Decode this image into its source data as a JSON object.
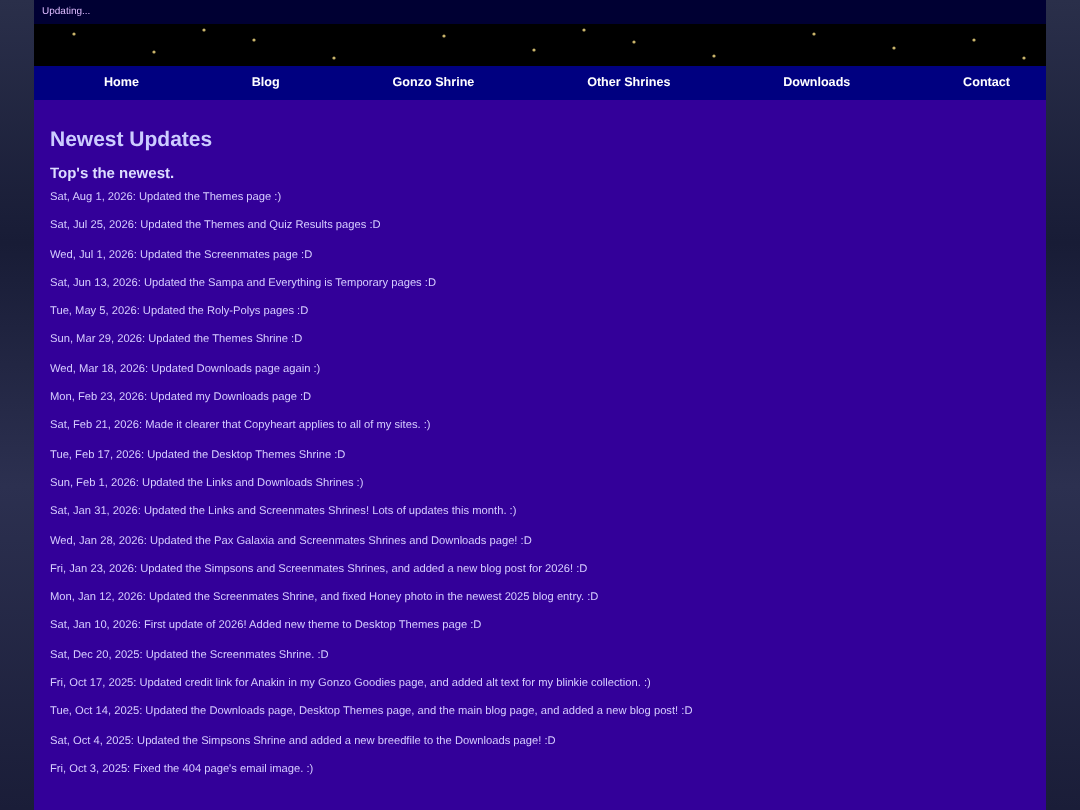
{
  "status_text": "Updating...",
  "nav": [
    {
      "label": "Home"
    },
    {
      "label": "Blog"
    },
    {
      "label": "Gonzo Shrine"
    },
    {
      "label": "Other Shrines"
    },
    {
      "label": "Downloads"
    },
    {
      "label": "Contact"
    }
  ],
  "heading": "Newest Updates",
  "subheading": "Top's the newest.",
  "updates": [
    "Sat, Aug 1, 2026: Updated the Themes page :)",
    "Sat, Jul 25, 2026: Updated the Themes and Quiz Results pages :D",
    "Wed, Jul 1, 2026: Updated the Screenmates page :D",
    "Sat, Jun 13, 2026: Updated the Sampa and Everything is Temporary pages :D",
    "Tue, May 5, 2026: Updated the Roly-Polys pages :D",
    "Sun, Mar 29, 2026: Updated the Themes Shrine :D",
    "Wed, Mar 18, 2026: Updated Downloads page again :)",
    "Mon, Feb 23, 2026: Updated my Downloads page :D",
    "Sat, Feb 21, 2026: Made it clearer that Copyheart applies to all of my sites. :)",
    "Tue, Feb 17, 2026: Updated the Desktop Themes Shrine :D",
    "Sun, Feb 1, 2026: Updated the Links and Downloads Shrines :)",
    "Sat, Jan 31, 2026: Updated the Links and Screenmates Shrines! Lots of updates this month. :)",
    "Wed, Jan 28, 2026: Updated the Pax Galaxia and Screenmates Shrines and Downloads page! :D",
    "Fri, Jan 23, 2026: Updated the Simpsons and Screenmates Shrines, and added a new blog post for 2026! :D",
    "Mon, Jan 12, 2026: Updated the Screenmates Shrine, and fixed Honey photo in the newest 2025 blog entry. :D",
    "Sat, Jan 10, 2026: First update of 2026! Added new theme to Desktop Themes page :D",
    "Sat, Dec 20, 2025: Updated the Screenmates Shrine. :D",
    "Fri, Oct 17, 2025: Updated credit link for Anakin in my Gonzo Goodies page, and added alt text for my blinkie collection. :)",
    "Tue, Oct 14, 2025: Updated the Downloads page, Desktop Themes page, and the main blog page, and added a new blog post! :D",
    "Sat, Oct 4, 2025: Updated the Simpsons Shrine and added a new breedfile to the Downloads page! :D",
    "Fri, Oct 3, 2025: Fixed the 404 page's email image. :)"
  ]
}
